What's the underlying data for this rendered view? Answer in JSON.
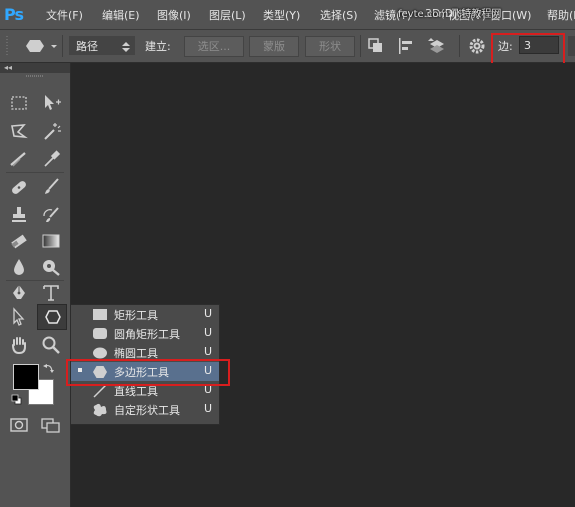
{
  "app": {
    "logo": "Ps"
  },
  "menubar": {
    "items": [
      "文件(F)",
      "编辑(E)",
      "图像(I)",
      "图层(L)",
      "类型(Y)",
      "选择(S)",
      "滤镜(T)",
      "3D(D)",
      "视图(V)",
      "窗口(W)",
      "帮助(H)"
    ]
  },
  "watermark": "fevte.com 飞特教程网",
  "options_bar": {
    "mode_value": "路径",
    "make_label": "建立:",
    "selection_button": "选区...",
    "mask_button": "蒙版",
    "shape_button": "形状",
    "sides_label": "边:",
    "sides_value": "3"
  },
  "toolbox": {
    "collapse_label": "◂◂"
  },
  "flyout": {
    "items": [
      {
        "icon": "rectangle-icon",
        "label": "矩形工具",
        "shortcut": "U",
        "selected": false
      },
      {
        "icon": "rounded-rectangle-icon",
        "label": "圆角矩形工具",
        "shortcut": "U",
        "selected": false
      },
      {
        "icon": "ellipse-icon",
        "label": "椭圆工具",
        "shortcut": "U",
        "selected": false
      },
      {
        "icon": "polygon-icon",
        "label": "多边形工具",
        "shortcut": "U",
        "selected": true
      },
      {
        "icon": "line-icon",
        "label": "直线工具",
        "shortcut": "U",
        "selected": false
      },
      {
        "icon": "custom-shape-icon",
        "label": "自定形状工具",
        "shortcut": "U",
        "selected": false
      }
    ]
  },
  "colors": {
    "accent": "#31a8ff",
    "highlight": "#d81e1e",
    "selected_row": "#59708e",
    "foreground": "#000000",
    "background": "#ffffff"
  }
}
